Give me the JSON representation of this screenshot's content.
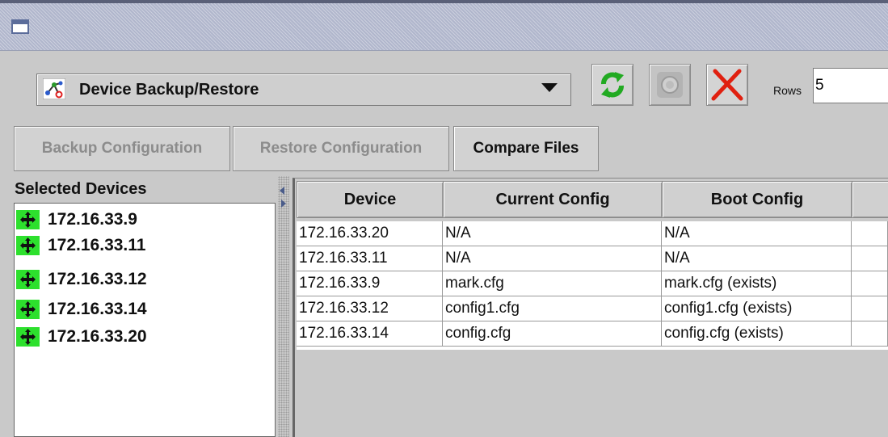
{
  "window": {
    "title": ""
  },
  "toolbar": {
    "tool_select": {
      "value": "Device Backup/Restore",
      "icon": "network-tool-icon"
    },
    "refresh_icon": "refresh-icon",
    "stop_icon": "stop-icon",
    "delete_icon": "delete-icon",
    "rows_label": "Rows",
    "rows_value": "5",
    "colors": {
      "refresh": "#22aa22",
      "delete": "#e02010"
    }
  },
  "actions": {
    "backup_label": "Backup Configuration",
    "restore_label": "Restore Configuration",
    "compare_label": "Compare Files"
  },
  "selected_devices": {
    "header": "Selected Devices",
    "icon": "device-node-icon",
    "items": [
      "172.16.33.9",
      "172.16.33.11",
      "172.16.33.12",
      "172.16.33.14",
      "172.16.33.20"
    ]
  },
  "table": {
    "columns": [
      "Device",
      "Current Config",
      "Boot Config",
      ""
    ],
    "rows": [
      [
        "172.16.33.20",
        "N/A",
        "N/A",
        ""
      ],
      [
        "172.16.33.11",
        "N/A",
        "N/A",
        ""
      ],
      [
        "172.16.33.9",
        "mark.cfg",
        "mark.cfg (exists)",
        ""
      ],
      [
        "172.16.33.12",
        "config1.cfg",
        "config1.cfg (exists)",
        ""
      ],
      [
        "172.16.33.14",
        "config.cfg",
        "config.cfg (exists)",
        ""
      ]
    ]
  }
}
